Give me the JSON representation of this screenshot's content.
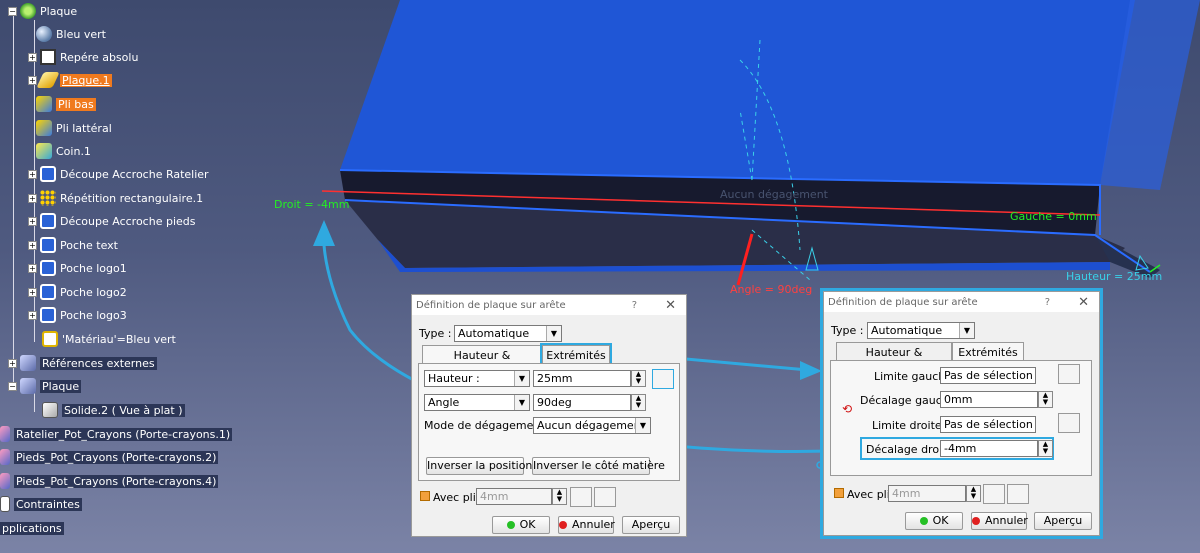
{
  "tree": {
    "items": [
      {
        "label": "Plaque",
        "icon": "gear-icon"
      },
      {
        "label": "Bleu vert",
        "icon": "sphere-icon"
      },
      {
        "label": "Repére absolu",
        "icon": "axis-system-icon"
      },
      {
        "label": "Plaque.1",
        "icon": "wall-icon"
      },
      {
        "label": "Pli bas",
        "icon": "flange-icon"
      },
      {
        "label": "Pli lattéral",
        "icon": "flange-icon"
      },
      {
        "label": "Coin.1",
        "icon": "corner-icon"
      },
      {
        "label": "Découpe Accroche Ratelier",
        "icon": "cutout-icon"
      },
      {
        "label": "Répétition rectangulaire.1",
        "icon": "pattern-icon"
      },
      {
        "label": "Découpe Accroche pieds",
        "icon": "cutout-icon"
      },
      {
        "label": "Poche text",
        "icon": "cutout-icon"
      },
      {
        "label": "Poche logo1",
        "icon": "cutout-icon"
      },
      {
        "label": "Poche logo2",
        "icon": "cutout-icon"
      },
      {
        "label": "Poche logo3",
        "icon": "cutout-icon"
      },
      {
        "label": "'Matériau'=Bleu vert",
        "icon": "material-icon"
      },
      {
        "label": "Références externes",
        "icon": "external-references-icon"
      },
      {
        "label": "Plaque",
        "icon": "part-body-icon"
      },
      {
        "label": "Solide.2 ( Vue à plat )",
        "icon": "solid-icon"
      },
      {
        "label": "Ratelier_Pot_Crayons (Porte-crayons.1)",
        "icon": "product-icon"
      },
      {
        "label": "Pieds_Pot_Crayons (Porte-crayons.2)",
        "icon": "product-icon"
      },
      {
        "label": "Pieds_Pot_Crayons (Porte-crayons.4)",
        "icon": "product-icon"
      },
      {
        "label": "Contraintes",
        "icon": "constraints-icon"
      },
      {
        "label": "pplications",
        "icon": "applications-icon"
      }
    ]
  },
  "viewport": {
    "droit_label": "Droit = -4mm",
    "gauche_label": "Gauche = 0mm",
    "hauteur_label": "Hauteur = 25mm",
    "angle_label": "Angle = 90deg",
    "degagement_label": "Aucun dégagement"
  },
  "dialog1": {
    "title": "Définition de plaque sur arête",
    "help": "?",
    "close": "✕",
    "type_label": "Type :",
    "type_value": "Automatique",
    "tab1": "Hauteur & inclinaison",
    "tab2": "Extrémités",
    "hauteur_combo": "Hauteur :",
    "hauteur_value": "25mm",
    "angle_combo": "Angle",
    "angle_value": "90deg",
    "mode_label": "Mode de dégagement :",
    "mode_value": "Aucun dégagemen",
    "invert_position": "Inverser la position",
    "invert_side": "Inverser le côté matière",
    "avec_pli": "Avec pli",
    "pli_value": "4mm",
    "ok": "OK",
    "cancel": "Annuler",
    "preview": "Aperçu"
  },
  "dialog2": {
    "title": "Définition de plaque sur arête",
    "help": "?",
    "close": "✕",
    "type_label": "Type :",
    "type_value": "Automatique",
    "tab1": "Hauteur & inclinaison",
    "tab2": "Extrémités",
    "limite_gauche_label": "Limite gauche :",
    "limite_gauche_value": "Pas de sélection",
    "decalage_gauche_label": "Décalage gauche :",
    "decalage_gauche_value": "0mm",
    "limite_droite_label": "Limite droite :",
    "limite_droite_value": "Pas de sélection",
    "decalage_droit_label": "Décalage droit :",
    "decalage_droit_value": "-4mm",
    "avec_pli": "Avec pli",
    "pli_value": "4mm",
    "ok": "OK",
    "cancel": "Annuler",
    "preview": "Aperçu"
  },
  "colors": {
    "accent": "#2fa9e0",
    "dimension": "#23f023",
    "highlight": "#f07a1e",
    "part_blue": "#1e5bd8"
  }
}
